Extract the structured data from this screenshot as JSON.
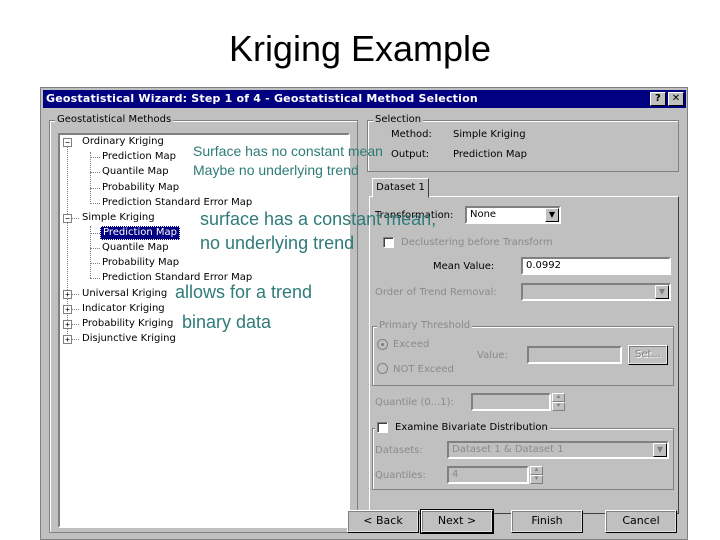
{
  "slide": {
    "title": "Kriging Example"
  },
  "dialog": {
    "title": "Geostatistical Wizard: Step 1 of 4 - Geostatistical Method Selection",
    "help_label": "?",
    "close_label": "✕",
    "methods_group_label": "Geostatistical Methods",
    "tree": {
      "ordinary_kriging": "Ordinary Kriging",
      "ok_prediction_map": "Prediction Map",
      "ok_quantile_map": "Quantile Map",
      "ok_probability_map": "Probability Map",
      "ok_prediction_std_error_map": "Prediction Standard Error Map",
      "simple_kriging": "Simple Kriging",
      "sk_prediction_map": "Prediction Map",
      "sk_quantile_map": "Quantile Map",
      "sk_probability_map": "Probability Map",
      "sk_prediction_std_error_map": "Prediction Standard Error Map",
      "universal_kriging": "Universal Kriging",
      "indicator_kriging": "Indicator Kriging",
      "probability_kriging": "Probability Kriging",
      "disjunctive_kriging": "Disjunctive Kriging"
    },
    "selection": {
      "group_label": "Selection",
      "method_label": "Method:",
      "method_value": "Simple Kriging",
      "output_label": "Output:",
      "output_value": "Prediction Map"
    },
    "dataset_tab": "Dataset 1",
    "transformation_label": "Transformation:",
    "transformation_value": "None",
    "declustering_label": "Declustering before Transform",
    "mean_value_label": "Mean Value:",
    "mean_value": "0.0992",
    "trend_removal_label": "Order of Trend Removal:",
    "primary_threshold": {
      "group_label": "Primary Threshold",
      "exceed": "Exceed",
      "not_exceed": "NOT Exceed",
      "value_label": "Value:",
      "set_button": "Set..."
    },
    "quantile_label": "Quantile (0...1):",
    "bivariate": {
      "group_label": "Examine Bivariate Distribution",
      "datasets_label": "Datasets:",
      "datasets_value": "Dataset 1 & Dataset 1",
      "quantiles_label": "Quantiles:",
      "quantiles_value": "4"
    },
    "buttons": {
      "back": "< Back",
      "next": "Next >",
      "finish": "Finish",
      "cancel": "Cancel"
    }
  },
  "annotations": {
    "ok_line1": "Surface has no constant mean",
    "ok_line2": "Maybe no underlying trend",
    "sk_line1": "surface has a constant mean,",
    "sk_line2": "no underlying trend",
    "uk_note": "allows for a trend",
    "ik_note": "binary data",
    "color": "#2e7b78"
  }
}
